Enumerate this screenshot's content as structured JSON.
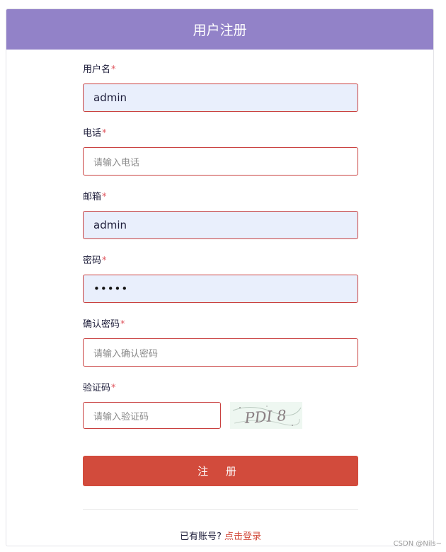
{
  "header": {
    "title": "用户注册"
  },
  "form": {
    "required_mark": "*",
    "username": {
      "label": "用户名",
      "value": "admin",
      "placeholder": ""
    },
    "phone": {
      "label": "电话",
      "value": "",
      "placeholder": "请输入电话"
    },
    "email": {
      "label": "邮箱",
      "value": "admin",
      "placeholder": ""
    },
    "password": {
      "label": "密码",
      "masked_value": "•••••"
    },
    "confirm_password": {
      "label": "确认密码",
      "placeholder": "请输入确认密码"
    },
    "captcha": {
      "label": "验证码",
      "placeholder": "请输入验证码",
      "image_text": "PDI 8"
    },
    "submit_label": "注 册"
  },
  "footer": {
    "prompt": "已有账号?",
    "login_link": "点击登录"
  },
  "watermark": "CSDN @Nils~",
  "colors": {
    "header_bg": "#9282c8",
    "accent": "#d24b3c",
    "input_border": "#c9403f",
    "filled_bg": "#e9effc"
  }
}
